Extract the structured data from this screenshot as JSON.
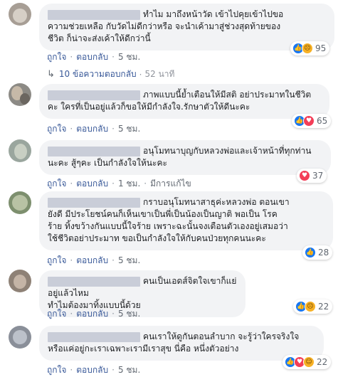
{
  "actions": {
    "like": "ถูกใจ",
    "reply": "ตอบกลับ",
    "sep": "·",
    "edited": "มีการแก้ไข"
  },
  "comments": [
    {
      "text": "ทำไม มาถึงหน้าวัด เข้าไปคุยเข้าไปขอ\nความช่วยเหลือ กับวัดไม่ดีกว่าหรือ จะนำเค้ามาสู่ช่วงสุดท้ายของ\nชีวิต ก็น่าจะส่งเค้าให้ดีกว่านี้",
      "time": "5 ชม.",
      "reactions": [
        "like",
        "sad"
      ],
      "reaction_count": "95",
      "replies_label": "10 ข้อความตอบกลับ",
      "replies_time": "52 นาที"
    },
    {
      "text": "ภาพแบบนี้ย้ำเตือนให้มีสติ อย่าประมาทในชีวิต\nคะ ใครที่เป็นอยู่แล้วก็ขอให้มีกำลังใจ.รักษาตัวให้ดีนะคะ",
      "time": "5 ชม.",
      "reactions": [
        "like",
        "heart"
      ],
      "reaction_count": "65"
    },
    {
      "text": "อนุโมทนาบุญกับหลวงพ่อและเจ้าหน้าที่ทุกท่าน\nนะคะ สู้ๆคะ เป็นกำลังใจให้นะคะ",
      "time": "1 ชม.",
      "edited": true,
      "reactions": [
        "heart"
      ],
      "reaction_count": "37"
    },
    {
      "text": "กราบอนุโมทนาสาธุค่ะหลวงพ่อ ตอนเขา\nยังดี มีประโยชน์คนก็เห็นเขาเป็นพี่เป็นน้องเป็นญาติ พอเป็น โรค\nร้าย ทิ้งขว้างกันแบบนี้ใจร้าย เพราะฉะนั้นจงเตือนตัวเองอยู่เสมอว่า\nใช้ชีวิตอย่าประมาท ขอเป็นกำลังใจให้กับคนป่วยทุกคนนะคะ",
      "time": "5 ชม.",
      "reactions": [
        "like"
      ],
      "reaction_count": "28"
    },
    {
      "text": "คนเป็นเอดส์จิตใจเขาก็แย่อยู่แล้วไหม\nทำไมต้องมาทิ้งแบบนี้ด้วย",
      "time": "5 ชม.",
      "reactions": [
        "like",
        "sad"
      ],
      "reaction_count": "22"
    },
    {
      "text": "คนเราให้ดูกันตอนลำบาก จะรู้ว่าใครจริงใจ\nหรือแค่อยู่กะเราเฉพาะเรามีเราสุข นี่คือ หนึ่งตัวอย่าง",
      "time": "5 ชม.",
      "reactions": [
        "like",
        "heart",
        "haha"
      ],
      "reaction_count": "22"
    }
  ]
}
